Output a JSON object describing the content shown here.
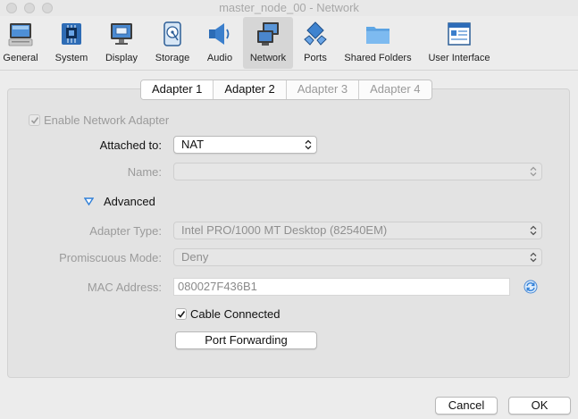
{
  "window": {
    "title": "master_node_00 - Network"
  },
  "toolbar": {
    "items": [
      {
        "label": "General",
        "icon": "general-icon"
      },
      {
        "label": "System",
        "icon": "system-icon"
      },
      {
        "label": "Display",
        "icon": "display-icon"
      },
      {
        "label": "Storage",
        "icon": "storage-icon"
      },
      {
        "label": "Audio",
        "icon": "audio-icon"
      },
      {
        "label": "Network",
        "icon": "network-icon",
        "active": true
      },
      {
        "label": "Ports",
        "icon": "ports-icon"
      },
      {
        "label": "Shared Folders",
        "icon": "shared-folders-icon"
      },
      {
        "label": "User Interface",
        "icon": "user-interface-icon"
      }
    ]
  },
  "tabs": [
    {
      "label": "Adapter 1",
      "selected": true
    },
    {
      "label": "Adapter 2",
      "enabled": true
    },
    {
      "label": "Adapter 3",
      "enabled": false
    },
    {
      "label": "Adapter 4",
      "enabled": false
    }
  ],
  "form": {
    "enable_adapter": {
      "label": "Enable Network Adapter",
      "checked": true
    },
    "attached_to": {
      "label": "Attached to:",
      "value": "NAT"
    },
    "name": {
      "label": "Name:",
      "value": ""
    },
    "advanced": {
      "label": "Advanced",
      "expanded": true
    },
    "adapter_type": {
      "label": "Adapter Type:",
      "value": "Intel PRO/1000 MT Desktop (82540EM)"
    },
    "promiscuous_mode": {
      "label": "Promiscuous Mode:",
      "value": "Deny"
    },
    "mac_address": {
      "label": "MAC Address:",
      "value": "080027F436B1"
    },
    "cable_connected": {
      "label": "Cable Connected",
      "checked": true
    },
    "port_forwarding": {
      "label": "Port Forwarding"
    }
  },
  "footer": {
    "cancel_label": "Cancel",
    "ok_label": "OK"
  },
  "colors": {
    "accent": "#2f7fd8",
    "disabled_text": "#9b9b9b"
  }
}
